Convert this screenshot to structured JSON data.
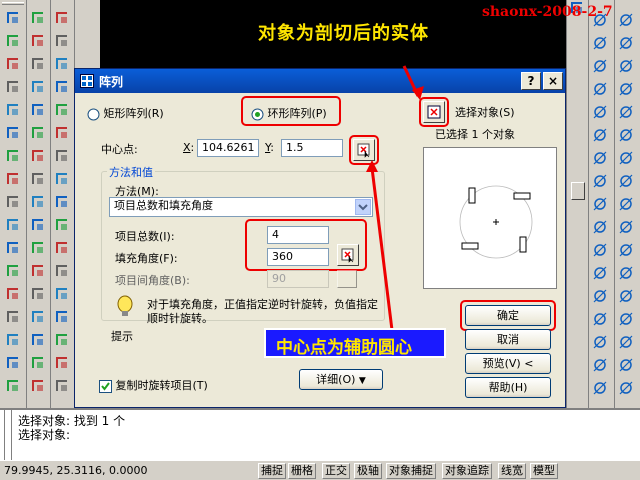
{
  "annotations": {
    "top_watermark": "shaonx-2008-2-7",
    "top_caption": "对象为剖切后的实体",
    "center_caption": "中心点为辅助圆心"
  },
  "dialog": {
    "title": "阵列",
    "help_button": "?",
    "close_button": "×",
    "rect_array_label": "矩形阵列",
    "rect_array_key": "(R)",
    "polar_array_label": "环形阵列",
    "polar_array_key": "(P)",
    "select_objects_label": "选择对象",
    "select_objects_key": "(S)",
    "selected_count": "已选择 1 个对象",
    "center_point_label": "中心点:",
    "x_label": "X",
    "x_value": "104.6261",
    "y_label": "Y",
    "y_value": "1.5",
    "method_group_label": "方法和值",
    "method_label": "方法",
    "method_key": "(M)",
    "method_value": "项目总数和填充角度",
    "total_items_label": "项目总数",
    "total_items_key": "(I)",
    "total_items_value": "4",
    "fill_angle_label": "填充角度",
    "fill_angle_key": "(F)",
    "fill_angle_value": "360",
    "item_angle_label": "项目间角度",
    "item_angle_key": "(B)",
    "item_angle_value": "90",
    "tip_text": "对于填充角度，正值指定逆时针旋转，负值指定顺时针旋转。",
    "tip_label": "提示",
    "rotate_items_label": "复制时旋转项目",
    "rotate_items_key": "(T)",
    "details_button": "详细",
    "details_key": "(O)",
    "details_arrow": "▼",
    "ok_button": "确定",
    "cancel_button": "取消",
    "preview_button": "预览",
    "preview_key": "(V)",
    "preview_arrow": "<",
    "help_text_button": "帮助",
    "help_key": "(H)"
  },
  "command": {
    "line1": "选择对象: 找到 1 个",
    "line2": "选择对象:"
  },
  "status": {
    "coords": "79.9945,  25.3116, 0.0000",
    "buttons": [
      "捕捉",
      "栅格",
      "正交",
      "极轴",
      "对象捕捉",
      "对象追踪",
      "线宽",
      "模型"
    ]
  },
  "colors": {
    "annotation_yellow": "#ffe600",
    "annotation_red": "#e00000",
    "callout_blue": "#1a1aff",
    "title_blue": "#0a5ed8"
  }
}
